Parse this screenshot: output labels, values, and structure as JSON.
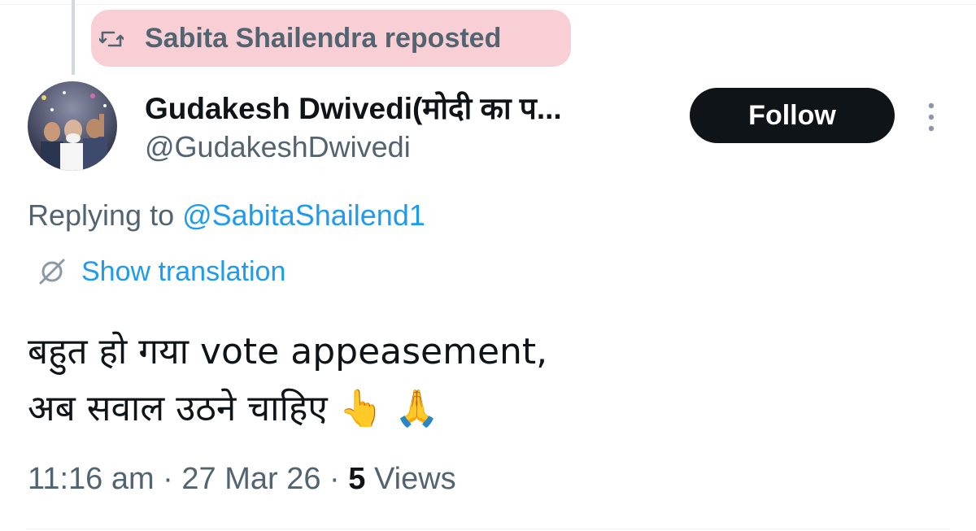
{
  "repost": {
    "text": "Sabita Shailendra reposted",
    "icon": "repost-icon",
    "highlight_color": "#f8c7cf"
  },
  "author": {
    "name": "Gudakesh Dwivedi(मोदी का प...",
    "handle": "@GudakeshDwivedi",
    "avatar_icon": "avatar-photo"
  },
  "follow_button": {
    "label": "Follow"
  },
  "more_menu": {
    "icon": "more-vertical-icon"
  },
  "replying": {
    "prefix": "Replying to ",
    "mention": "@SabitaShailend1"
  },
  "translation": {
    "icon": "globe-icon",
    "label": "Show translation"
  },
  "tweet": {
    "line1": "बहुत हो गया vote appeasement,",
    "line2": "अब सवाल उठने चाहिए 👆 🙏"
  },
  "meta": {
    "time": "11:16 am",
    "separator1": " · ",
    "date": "27 Mar 26",
    "separator2": " · ",
    "views_count": "5",
    "views_label": " Views"
  },
  "colors": {
    "text_primary": "#0f1419",
    "text_secondary": "#536471",
    "link": "#1d9bf0",
    "button_bg": "#0f1419"
  }
}
